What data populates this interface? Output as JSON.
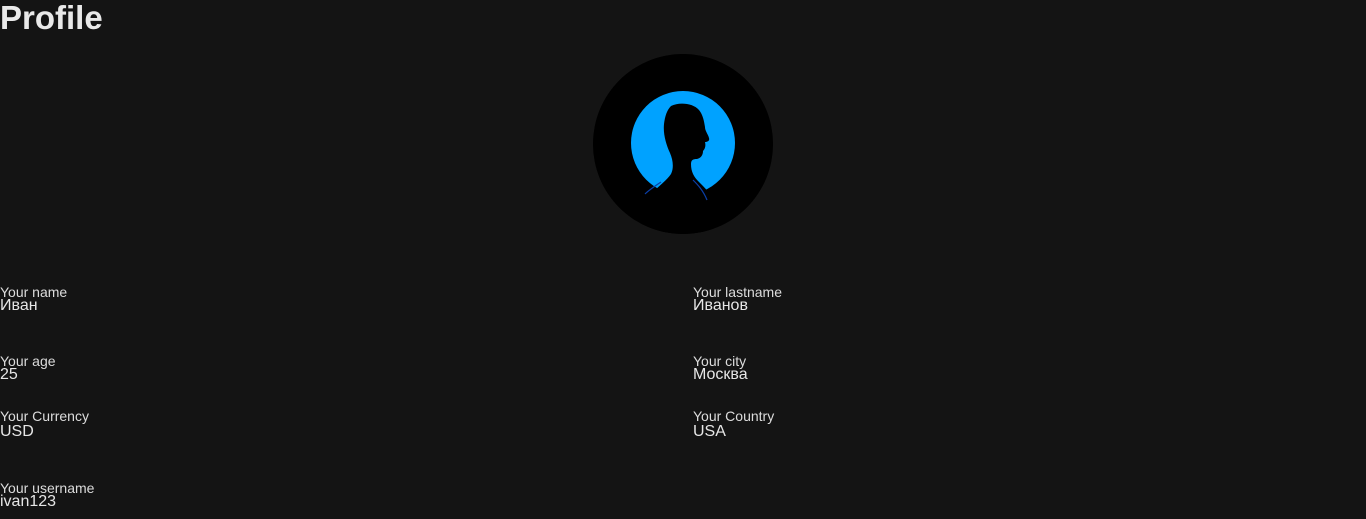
{
  "page": {
    "title": "Profile"
  },
  "avatar": {
    "icon": "user-silhouette-icon",
    "ring_color": "#00a2ff",
    "background_color": "#000000"
  },
  "fields": {
    "name": {
      "label": "Your name",
      "value": "Иван"
    },
    "lastname": {
      "label": "Your lastname",
      "value": "Иванов"
    },
    "age": {
      "label": "Your age",
      "value": "25"
    },
    "city": {
      "label": "Your city",
      "value": "Москва"
    },
    "currency": {
      "label": "Your Currency",
      "value": "USD"
    },
    "country": {
      "label": "Your Country",
      "value": "USA"
    },
    "username": {
      "label": "Your username",
      "value": "ivan123"
    }
  }
}
